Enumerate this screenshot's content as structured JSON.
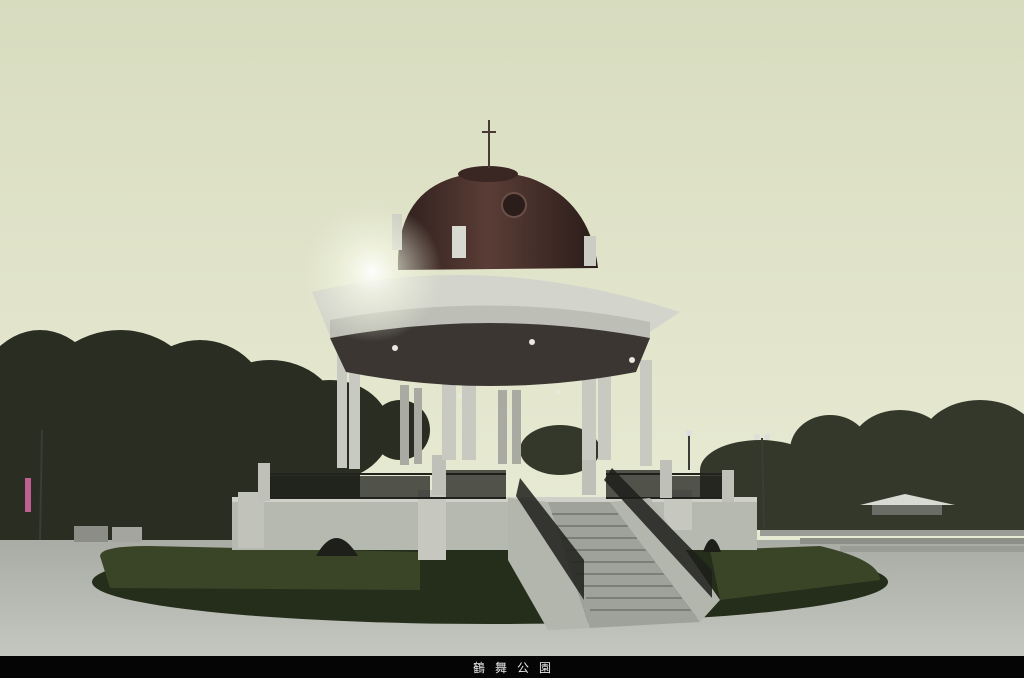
{
  "photo": {
    "subject": "bandstand-gazebo",
    "colors": {
      "sky_top": "#dcdfc3",
      "sky_bottom": "#e9ebd4",
      "dome": "#3d2a26",
      "stone": "#b9bcb3",
      "trees": "#2a2e22",
      "hedge": "#2f3a22",
      "ground": "#b8bab4"
    }
  },
  "caption": {
    "text": "鶴舞公園"
  }
}
